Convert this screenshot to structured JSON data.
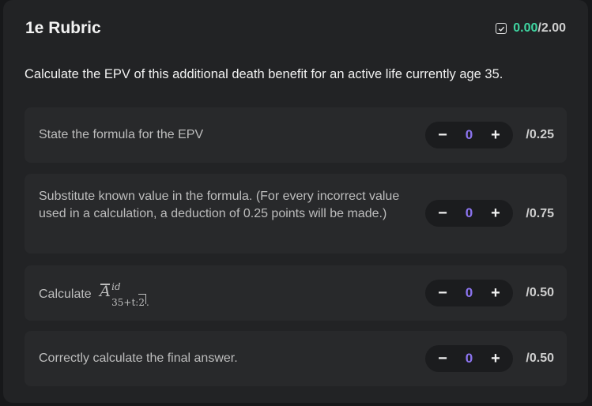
{
  "header": {
    "title": "1e Rubric",
    "score_earned": "0.00",
    "score_total": "/2.00",
    "check_icon": "checkbox-checked-icon"
  },
  "question": "Calculate the EPV of this additional death benefit for an active life currently age 35.",
  "items": [
    {
      "label": "State the formula for the EPV",
      "value": "0",
      "max": "/0.25"
    },
    {
      "label": "Substitute known value in the formula. (For every incorrect value used in a calculation, a deduction of 0.25 points will be made.)",
      "value": "0",
      "max": "/0.75"
    },
    {
      "label": "Calculate",
      "math": {
        "symbol": "A",
        "sup": "id",
        "sub": "35+t:2",
        "trail": "."
      },
      "value": "0",
      "max": "/0.50"
    },
    {
      "label": "Correctly calculate the final answer.",
      "value": "0",
      "max": "/0.50"
    }
  ],
  "stepper": {
    "minus": "−",
    "plus": "+"
  },
  "colors": {
    "earned": "#3fd6a2",
    "value": "#8c74f0",
    "panel": "#222325",
    "item": "#28292b"
  }
}
